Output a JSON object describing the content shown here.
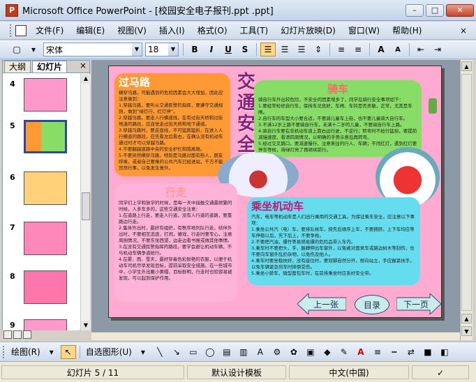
{
  "window": {
    "app_icon": "powerpoint-icon",
    "title": "Microsoft Office PowerPoint - [校园安全电子报刊.ppt .ppt]",
    "buttons": {
      "minimize": "–",
      "maximize": "□",
      "close": "✕"
    }
  },
  "menu": {
    "items": [
      "文件(F)",
      "编辑(E)",
      "视图(V)",
      "插入(I)",
      "格式(O)",
      "工具(T)",
      "幻灯片放映(D)",
      "窗口(W)",
      "帮助(H)"
    ],
    "help_box": "×"
  },
  "format_toolbar": {
    "font": "宋体",
    "size": "18",
    "bold": "B",
    "italic": "I",
    "underline": "U",
    "shadow": "S",
    "align_left_active": true
  },
  "outline_pane": {
    "tabs": [
      "大纲",
      "幻灯片"
    ],
    "active_tab": "幻灯片",
    "close": "×",
    "slides": [
      "4",
      "5",
      "6",
      "7",
      "8",
      "9"
    ],
    "selected_slide": "5"
  },
  "slide": {
    "vertical_title": [
      "交",
      "通",
      "安",
      "全"
    ],
    "boxes": [
      {
        "title": "过马路",
        "color": "#ff9933",
        "title_color": "#ffffff",
        "text": "横穿马路，可能遇到的危险因素会大大增加，因此应注意做到：\n1.穿越马路，要听从交通民警的指挥，要遵守交通规则，做到“绿灯行，红灯停”。\n2.穿越马路，要走人行横道线，在有过街天桥和过街地道的路段，应自觉走过街天桥和地下通道。\n3.穿越马路时，要走直线，不可猛跑猛折，在进入人行横道的路段，应先看左后看右，在确认没有机动车通过时才可以穿越马路。\n4.不要翻越道路中央的安全护栏和隔离墩。\n5.不要突然横穿马路，特别是马路对面有熟人，朋友呼唤，或者自己要乘的公共汽车已经进站，千万不能贸然行事，以免发生意外。"
      },
      {
        "title": "骑车",
        "color": "#88dd66",
        "title_color": "#ff6666",
        "text": "骑自行车外出较危险，不安全的因素增多了，同学在骑行安全事项如下：\n1.要经常检修自行车，保持车况良好，车闸、车铃是否灵敏，正常，尤其是车闸。\n2.自行车的车型大小要合适，不要骑儿童车上街，也不要儿童骑大自行车。\n3.不满12岁上路不要骑自行车，未满十二岁的儿童，不要骑自行车上路。\n4.骑自行车要在非机动车道上靠右边行驶，不逆行；转弯时不抢行猛拐，要提前减慢速度，看清四周情况，以明确的手势示意后再转弯。\n5.经过交叉路口，要减速慢行，注意来往的行人、车辆；不闯红灯，遇到红灯要停车等候，待绿灯亮了再继续前行。"
      },
      {
        "title": "行走",
        "color": "#ffb3d9",
        "title_color": "#ff9999",
        "text": "同学们上学和放学的时候，是每一天中接触交通最频繁的时候，人多车多的，这些交通安全注意：\n1.在道路上行走，要走人行道，没有人行道的道路，要靠路边行走。\n2.集体外出时，最好有组织，有秩序地列队行走，结伴外出时，不要相互追逐，打闹，嬉戏，行走时要专心，注意周围情况，不要东张西望，边走边看书报或做其他事情。\n3.在没有交通民警指挥的路段，要学会避让机动车辆，不与机动车辆争道抢行。\n4.在雾、雨、雪天，最好穿着色彩鲜艳的衣服，以便于机动车司机尽早发现目标，提前采取安全措施。在一些城市中，小学生外出戴小黄帽，目标鲜明，行走时也较容易被发现，可以起到保护作用。"
      },
      {
        "title": "乘坐机动车",
        "color": "#66ddee",
        "title_color": "#cc1177",
        "text": "汽车，电车等机动车是人们出行乘用的交通工具，为保证乘车安全，应注意以下事项：\n1.乘坐公共汽（电）车，要排队候车，按先后顺序上车，不要拥挤。上下车均应等车停稳以后，先下后上，不要争抢。\n2.不要把汽油，爆竹等易燃易爆的危险品带入车内。\n3.乘车时不要把头，手，胳膊伸出车窗外，以免被对面来车或路边树木等刮伤，也不要向车窗外乱扔杂物，以免伤及他人。\n4.乘车时要坐稳扶好，没有座位时，要双脚自然分开，侧向站立，手应握紧扶手，以免车辆紧急刹车时摔倒受伤。\n5.乘坐小轿车，微型面包车时，在前排乘坐时应系好安全带。"
      }
    ],
    "nav": {
      "prev": "上一张",
      "toc": "目录",
      "next": "下一页"
    }
  },
  "drawing_toolbar": {
    "draw_label": "绘图(R)",
    "autoshape_label": "自选图形(U)"
  },
  "status": {
    "slide_info": "幻灯片 5 / 11",
    "template": "默认设计模板",
    "language": "中文(中国)"
  }
}
